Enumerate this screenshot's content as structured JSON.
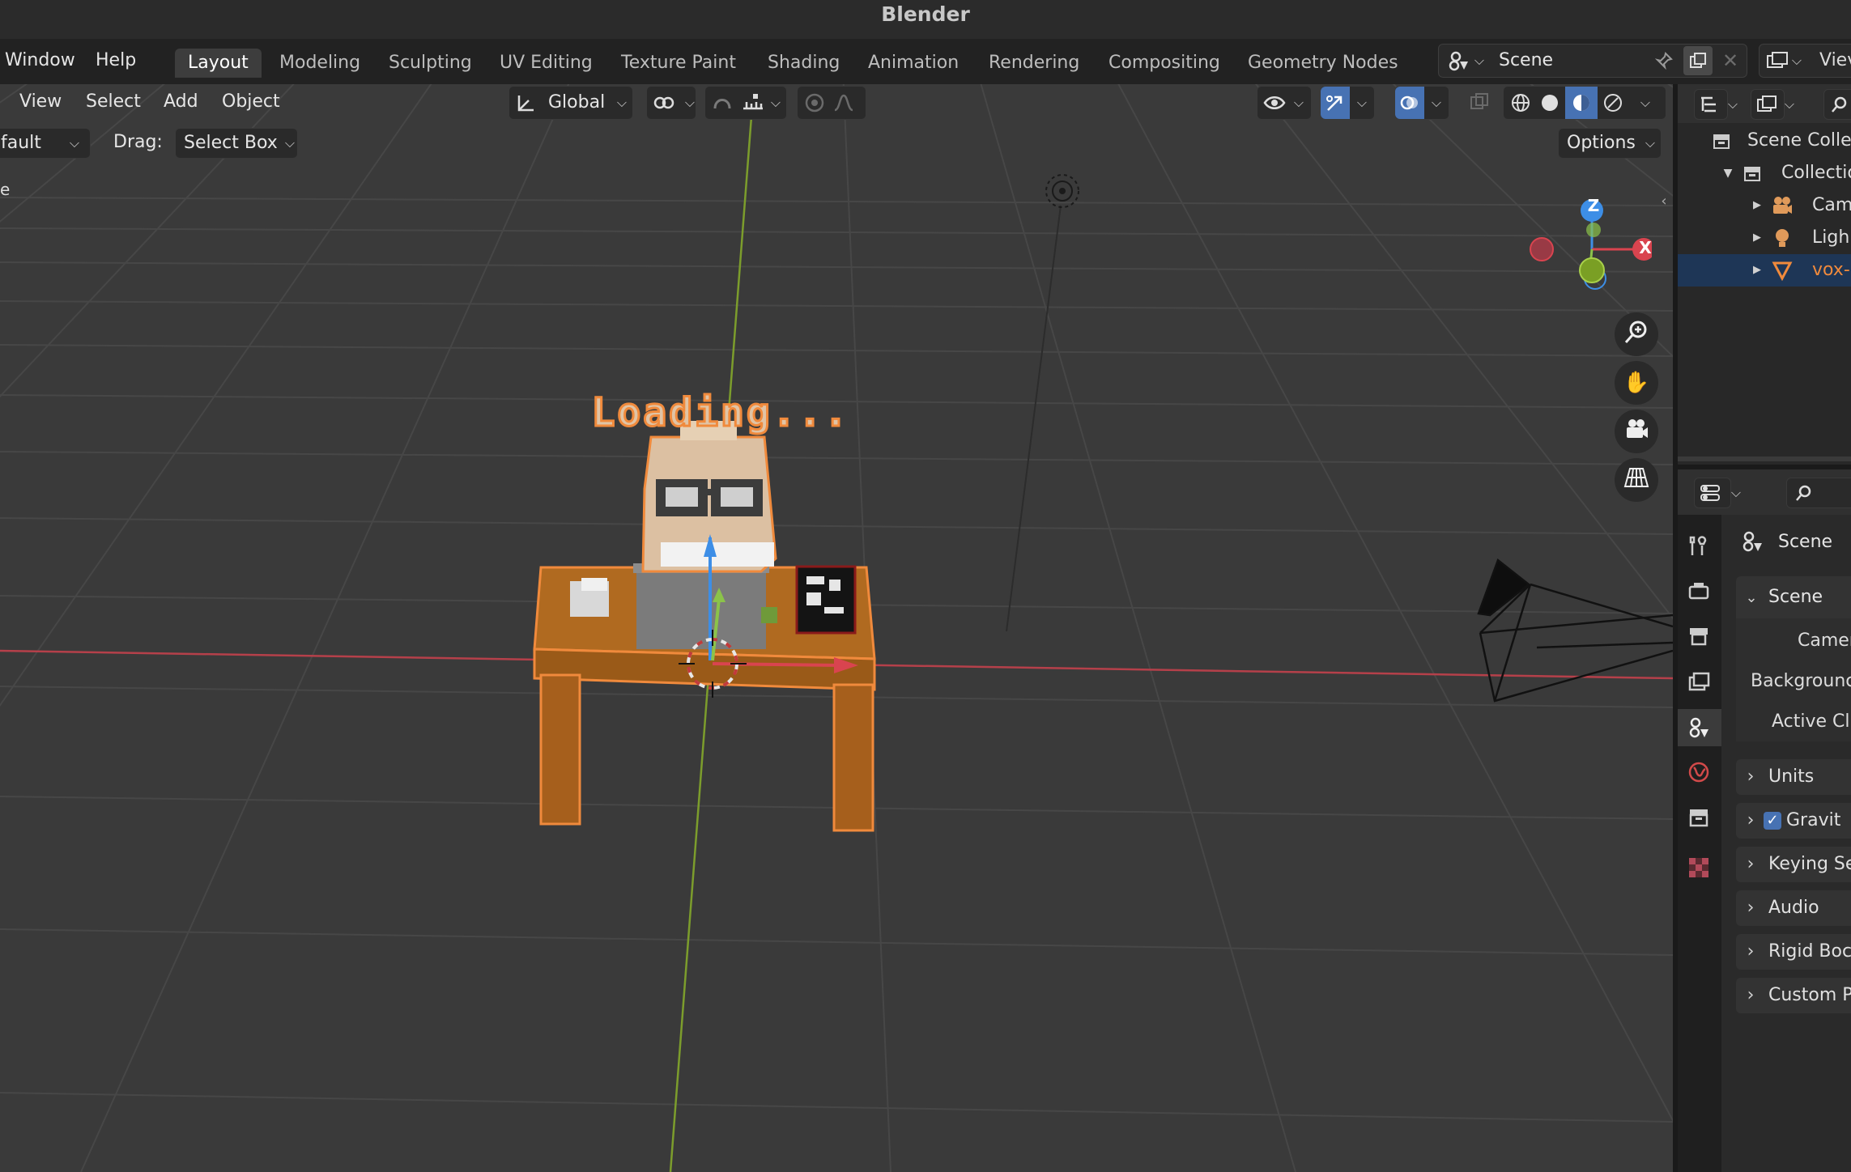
{
  "app": {
    "title": "Blender"
  },
  "menu": {
    "window": "Window",
    "help": "Help"
  },
  "workspaces": [
    "Layout",
    "Modeling",
    "Sculpting",
    "UV Editing",
    "Texture Paint",
    "Shading",
    "Animation",
    "Rendering",
    "Compositing",
    "Geometry Nodes"
  ],
  "scene_selector": {
    "value": "Scene"
  },
  "view_layer_label": "Viev",
  "viewport_header": {
    "view": "View",
    "select": "Select",
    "add": "Add",
    "object": "Object",
    "orientation": "Global"
  },
  "tool_settings": {
    "mode_partial": "fault",
    "drag_label": "Drag:",
    "drag_value": "Select Box",
    "options": "Options",
    "left_edge_text": "e"
  },
  "gizmo": {
    "z": "Z",
    "x": "X"
  },
  "scene_text": "Loading...",
  "outliner": {
    "scene_collection": "Scene Colle",
    "collection": "Collectio",
    "items": [
      {
        "label": "Cam",
        "icon": "camera-icon"
      },
      {
        "label": "Ligh",
        "icon": "light-icon"
      },
      {
        "label": "vox-",
        "icon": "mesh-icon",
        "selected": true
      }
    ]
  },
  "properties": {
    "breadcrumb": "Scene",
    "panel_title": "Scene",
    "fields": [
      "Camer",
      "Backgrounc",
      "Active Cl"
    ],
    "subpanels": [
      {
        "label": "Units",
        "checkbox": false
      },
      {
        "label": "Gravit",
        "checkbox": true
      },
      {
        "label": "Keying Se",
        "checkbox": false
      },
      {
        "label": "Audio",
        "checkbox": false
      },
      {
        "label": "Rigid Boc",
        "checkbox": false
      },
      {
        "label": "Custom P",
        "checkbox": false
      }
    ]
  },
  "colors": {
    "selection_orange": "#f08a3c",
    "x_axis": "#d9444f",
    "y_axis": "#8bc34a",
    "z_axis": "#3d8ee6",
    "active_blue": "#4772b3"
  }
}
